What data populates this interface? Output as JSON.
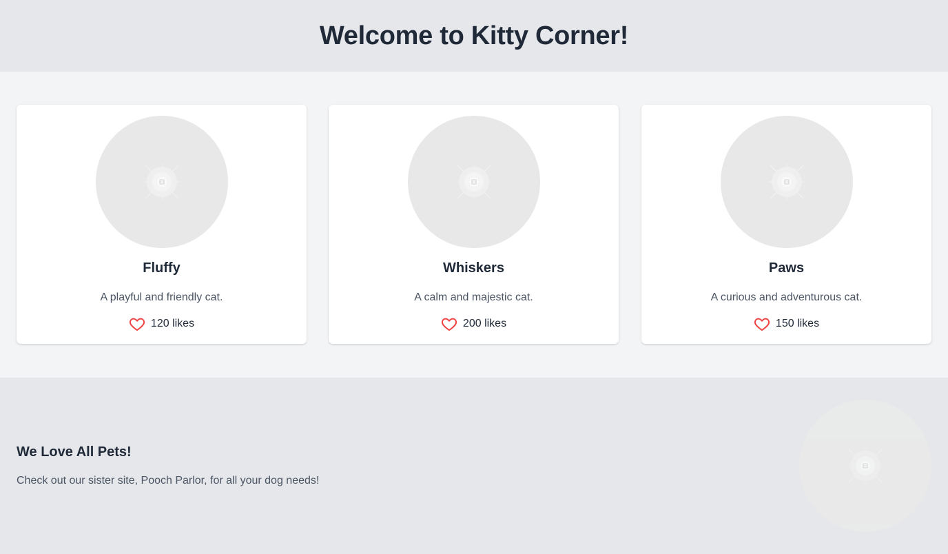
{
  "header": {
    "title": "Welcome to Kitty Corner!"
  },
  "cats": [
    {
      "name": "Fluffy",
      "description": "A playful and friendly cat.",
      "likes_label": "120 likes",
      "likes": 120
    },
    {
      "name": "Whiskers",
      "description": "A calm and majestic cat.",
      "likes_label": "200 likes",
      "likes": 200
    },
    {
      "name": "Paws",
      "description": "A curious and adventurous cat.",
      "likes_label": "150 likes",
      "likes": 150
    }
  ],
  "footer": {
    "title": "We Love All Pets!",
    "text": "Check out our sister site, Pooch Parlor, for all your dog needs!"
  },
  "colors": {
    "header_bg": "#e5e7eb",
    "main_bg": "#f3f4f6",
    "card_bg": "#ffffff",
    "heart": "#ef4444",
    "title_text": "#1f2937",
    "muted_text": "#4b5563"
  },
  "icons": {
    "like": "heart-icon",
    "image_placeholder": "image-placeholder-icon"
  }
}
